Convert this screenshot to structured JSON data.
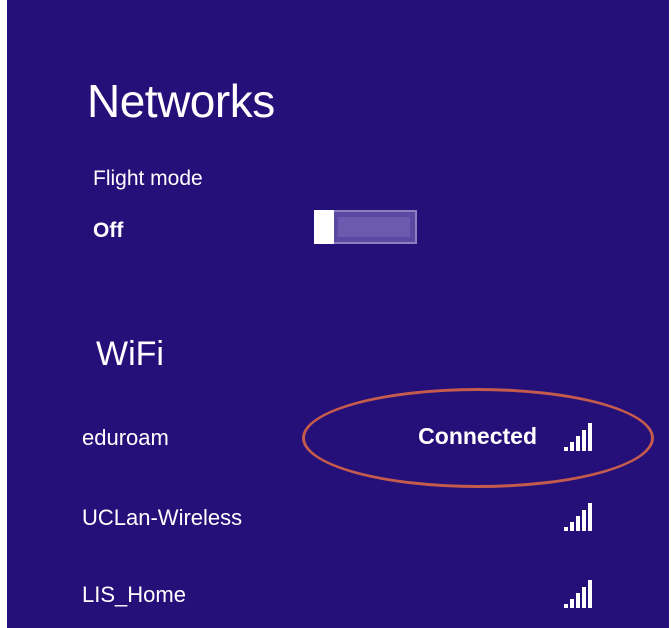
{
  "panel": {
    "title": "Networks"
  },
  "flight_mode": {
    "label": "Flight mode",
    "state": "Off",
    "enabled": false
  },
  "wifi": {
    "heading": "WiFi",
    "networks": [
      {
        "name": "eduroam",
        "status": "Connected",
        "signal": "full"
      },
      {
        "name": "UCLan-Wireless",
        "status": "",
        "signal": "full"
      },
      {
        "name": "LIS_Home",
        "status": "",
        "signal": "full"
      }
    ]
  },
  "colors": {
    "background": "#25107a",
    "highlight_oval": "#c55b4c"
  }
}
